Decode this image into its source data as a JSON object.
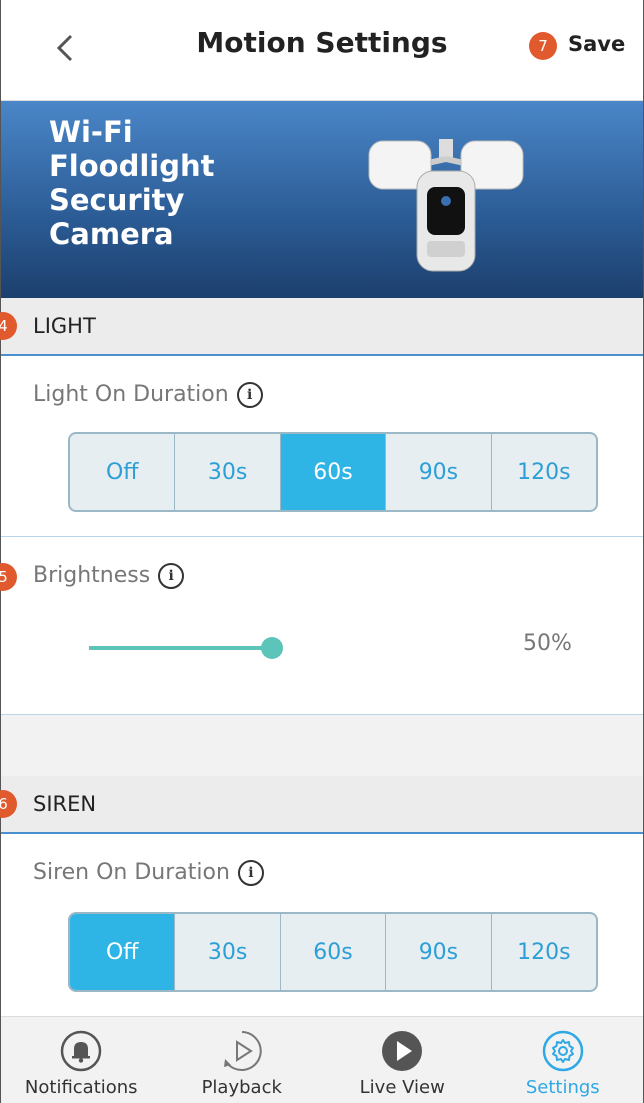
{
  "header": {
    "title": "Motion Settings",
    "save_label": "Save",
    "save_badge": "7"
  },
  "banner": {
    "title": "Wi-Fi Floodlight Security Camera"
  },
  "light": {
    "section_label": "LIGHT",
    "section_badge": "4",
    "duration_label": "Light On Duration",
    "duration_options": [
      "Off",
      "30s",
      "60s",
      "90s",
      "120s"
    ],
    "duration_selected": "60s",
    "brightness_label": "Brightness",
    "brightness_badge": "5",
    "brightness_value": "50%",
    "brightness_fraction": 0.5
  },
  "siren": {
    "section_label": "SIREN",
    "section_badge": "6",
    "duration_label": "Siren On Duration",
    "duration_options": [
      "Off",
      "30s",
      "60s",
      "90s",
      "120s"
    ],
    "duration_selected": "Off"
  },
  "info_glyph": "i",
  "tabs": [
    {
      "label": "Notifications",
      "icon": "bell-icon"
    },
    {
      "label": "Playback",
      "icon": "playback-icon"
    },
    {
      "label": "Live View",
      "icon": "play-icon"
    },
    {
      "label": "Settings",
      "icon": "gear-icon",
      "active": true
    }
  ],
  "colors": {
    "accent": "#2fb4e6",
    "badge": "#e05a2e",
    "slider": "#5cc4b8",
    "banner": "#2b5b94"
  }
}
